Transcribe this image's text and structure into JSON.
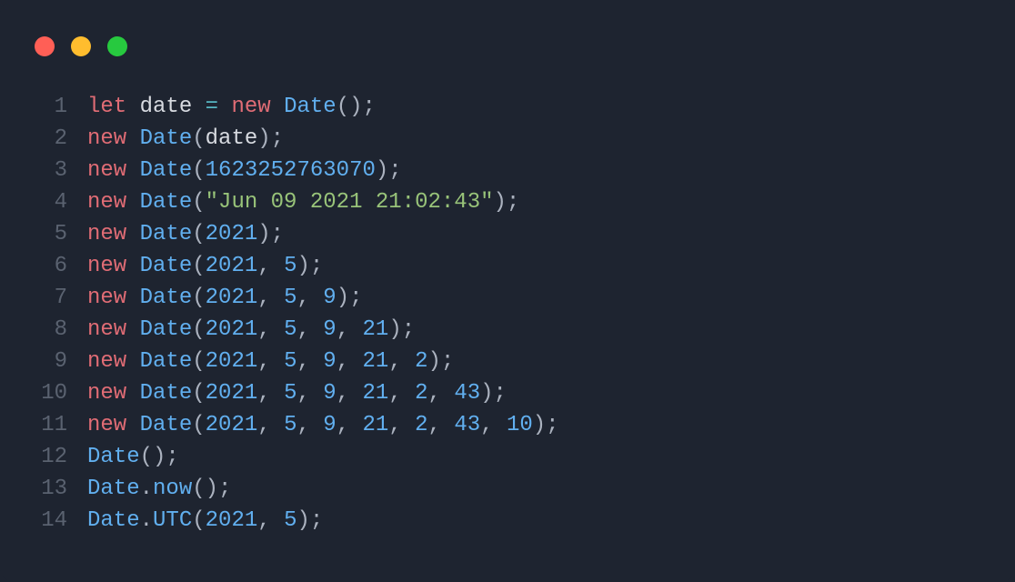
{
  "traffic_lights": [
    "close",
    "minimize",
    "zoom"
  ],
  "code": {
    "lines": [
      {
        "n": 1,
        "tokens": [
          [
            "kw",
            "let"
          ],
          [
            "pun",
            " "
          ],
          [
            "id",
            "date"
          ],
          [
            "pun",
            " "
          ],
          [
            "op",
            "="
          ],
          [
            "pun",
            " "
          ],
          [
            "kw",
            "new"
          ],
          [
            "pun",
            " "
          ],
          [
            "cls",
            "Date"
          ],
          [
            "pun",
            "();"
          ]
        ]
      },
      {
        "n": 2,
        "tokens": [
          [
            "kw",
            "new"
          ],
          [
            "pun",
            " "
          ],
          [
            "cls",
            "Date"
          ],
          [
            "pun",
            "("
          ],
          [
            "id",
            "date"
          ],
          [
            "pun",
            ");"
          ]
        ]
      },
      {
        "n": 3,
        "tokens": [
          [
            "kw",
            "new"
          ],
          [
            "pun",
            " "
          ],
          [
            "cls",
            "Date"
          ],
          [
            "pun",
            "("
          ],
          [
            "num",
            "1623252763070"
          ],
          [
            "pun",
            ");"
          ]
        ]
      },
      {
        "n": 4,
        "tokens": [
          [
            "kw",
            "new"
          ],
          [
            "pun",
            " "
          ],
          [
            "cls",
            "Date"
          ],
          [
            "pun",
            "("
          ],
          [
            "str",
            "\"Jun 09 2021 21:02:43\""
          ],
          [
            "pun",
            ");"
          ]
        ]
      },
      {
        "n": 5,
        "tokens": [
          [
            "kw",
            "new"
          ],
          [
            "pun",
            " "
          ],
          [
            "cls",
            "Date"
          ],
          [
            "pun",
            "("
          ],
          [
            "num",
            "2021"
          ],
          [
            "pun",
            ");"
          ]
        ]
      },
      {
        "n": 6,
        "tokens": [
          [
            "kw",
            "new"
          ],
          [
            "pun",
            " "
          ],
          [
            "cls",
            "Date"
          ],
          [
            "pun",
            "("
          ],
          [
            "num",
            "2021"
          ],
          [
            "pun",
            ", "
          ],
          [
            "num",
            "5"
          ],
          [
            "pun",
            ");"
          ]
        ]
      },
      {
        "n": 7,
        "tokens": [
          [
            "kw",
            "new"
          ],
          [
            "pun",
            " "
          ],
          [
            "cls",
            "Date"
          ],
          [
            "pun",
            "("
          ],
          [
            "num",
            "2021"
          ],
          [
            "pun",
            ", "
          ],
          [
            "num",
            "5"
          ],
          [
            "pun",
            ", "
          ],
          [
            "num",
            "9"
          ],
          [
            "pun",
            ");"
          ]
        ]
      },
      {
        "n": 8,
        "tokens": [
          [
            "kw",
            "new"
          ],
          [
            "pun",
            " "
          ],
          [
            "cls",
            "Date"
          ],
          [
            "pun",
            "("
          ],
          [
            "num",
            "2021"
          ],
          [
            "pun",
            ", "
          ],
          [
            "num",
            "5"
          ],
          [
            "pun",
            ", "
          ],
          [
            "num",
            "9"
          ],
          [
            "pun",
            ", "
          ],
          [
            "num",
            "21"
          ],
          [
            "pun",
            ");"
          ]
        ]
      },
      {
        "n": 9,
        "tokens": [
          [
            "kw",
            "new"
          ],
          [
            "pun",
            " "
          ],
          [
            "cls",
            "Date"
          ],
          [
            "pun",
            "("
          ],
          [
            "num",
            "2021"
          ],
          [
            "pun",
            ", "
          ],
          [
            "num",
            "5"
          ],
          [
            "pun",
            ", "
          ],
          [
            "num",
            "9"
          ],
          [
            "pun",
            ", "
          ],
          [
            "num",
            "21"
          ],
          [
            "pun",
            ", "
          ],
          [
            "num",
            "2"
          ],
          [
            "pun",
            ");"
          ]
        ]
      },
      {
        "n": 10,
        "tokens": [
          [
            "kw",
            "new"
          ],
          [
            "pun",
            " "
          ],
          [
            "cls",
            "Date"
          ],
          [
            "pun",
            "("
          ],
          [
            "num",
            "2021"
          ],
          [
            "pun",
            ", "
          ],
          [
            "num",
            "5"
          ],
          [
            "pun",
            ", "
          ],
          [
            "num",
            "9"
          ],
          [
            "pun",
            ", "
          ],
          [
            "num",
            "21"
          ],
          [
            "pun",
            ", "
          ],
          [
            "num",
            "2"
          ],
          [
            "pun",
            ", "
          ],
          [
            "num",
            "43"
          ],
          [
            "pun",
            ");"
          ]
        ]
      },
      {
        "n": 11,
        "tokens": [
          [
            "kw",
            "new"
          ],
          [
            "pun",
            " "
          ],
          [
            "cls",
            "Date"
          ],
          [
            "pun",
            "("
          ],
          [
            "num",
            "2021"
          ],
          [
            "pun",
            ", "
          ],
          [
            "num",
            "5"
          ],
          [
            "pun",
            ", "
          ],
          [
            "num",
            "9"
          ],
          [
            "pun",
            ", "
          ],
          [
            "num",
            "21"
          ],
          [
            "pun",
            ", "
          ],
          [
            "num",
            "2"
          ],
          [
            "pun",
            ", "
          ],
          [
            "num",
            "43"
          ],
          [
            "pun",
            ", "
          ],
          [
            "num",
            "10"
          ],
          [
            "pun",
            ");"
          ]
        ]
      },
      {
        "n": 12,
        "tokens": [
          [
            "cls",
            "Date"
          ],
          [
            "pun",
            "();"
          ]
        ]
      },
      {
        "n": 13,
        "tokens": [
          [
            "cls",
            "Date"
          ],
          [
            "pun",
            "."
          ],
          [
            "cls",
            "now"
          ],
          [
            "pun",
            "();"
          ]
        ]
      },
      {
        "n": 14,
        "tokens": [
          [
            "cls",
            "Date"
          ],
          [
            "pun",
            "."
          ],
          [
            "cls",
            "UTC"
          ],
          [
            "pun",
            "("
          ],
          [
            "num",
            "2021"
          ],
          [
            "pun",
            ", "
          ],
          [
            "num",
            "5"
          ],
          [
            "pun",
            ");"
          ]
        ]
      }
    ]
  }
}
